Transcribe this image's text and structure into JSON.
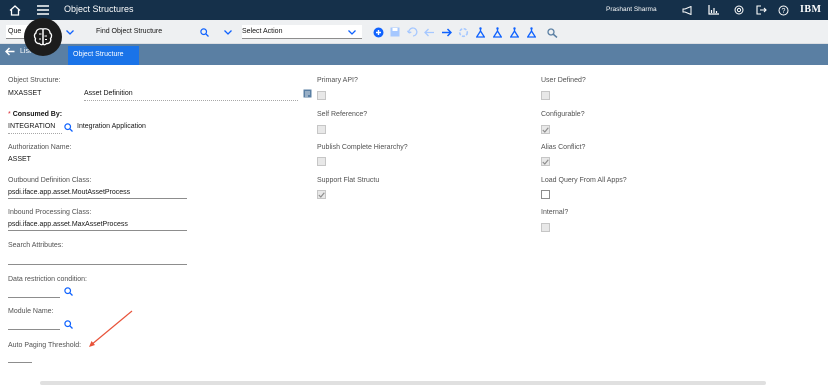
{
  "header": {
    "title": "Object Structures",
    "user": "Prashant Sharma",
    "brand": "IBM"
  },
  "toolbar": {
    "query_value": "Que",
    "find_placeholder": "Find Object Structure",
    "select_action": "Select Action"
  },
  "tabs": {
    "list_label": "List View",
    "active_label": "Object Structure"
  },
  "form": {
    "object_structure_label": "Object Structure:",
    "object_structure_value": "MXASSET",
    "object_structure_desc": "Asset Definition",
    "consumed_by_required": "*",
    "consumed_by_label": "Consumed By:",
    "consumed_by_value": "INTEGRATION",
    "consumed_by_desc": "Integration Application",
    "authorization_label": "Authorization Name:",
    "authorization_value": "ASSET",
    "outbound_label": "Outbound Definition Class:",
    "outbound_value": "psdi.iface.app.asset.MoutAssetProcess",
    "inbound_label": "Inbound Processing Class:",
    "inbound_value": "psdi.iface.app.asset.MaxAssetProcess",
    "search_attr_label": "Search Attributes:",
    "data_restriction_label": "Data restriction condition:",
    "module_label": "Module Name:",
    "auto_paging_label": "Auto Paging Threshold:"
  },
  "checks_middle": [
    {
      "label": "Primary API?",
      "checked": false,
      "enabled": false
    },
    {
      "label": "Self Reference?",
      "checked": false,
      "enabled": false
    },
    {
      "label": "Publish Complete Hierarchy?",
      "checked": false,
      "enabled": false
    },
    {
      "label": "Support Flat Structu",
      "checked": true,
      "enabled": false
    }
  ],
  "checks_right": [
    {
      "label": "User Defined?",
      "checked": false,
      "enabled": false
    },
    {
      "label": "Configurable?",
      "checked": true,
      "enabled": false
    },
    {
      "label": "Alias Conflict?",
      "checked": true,
      "enabled": false
    },
    {
      "label": "Load Query From All Apps?",
      "checked": false,
      "enabled": true
    },
    {
      "label": "Internal?",
      "checked": false,
      "enabled": false
    }
  ],
  "colors": {
    "header_bg": "#15304a",
    "tabbar_bg": "#5a7fa3",
    "tab_active": "#1a73e8",
    "link_blue": "#0f62fe",
    "annotation_arrow": "#e8533a"
  }
}
